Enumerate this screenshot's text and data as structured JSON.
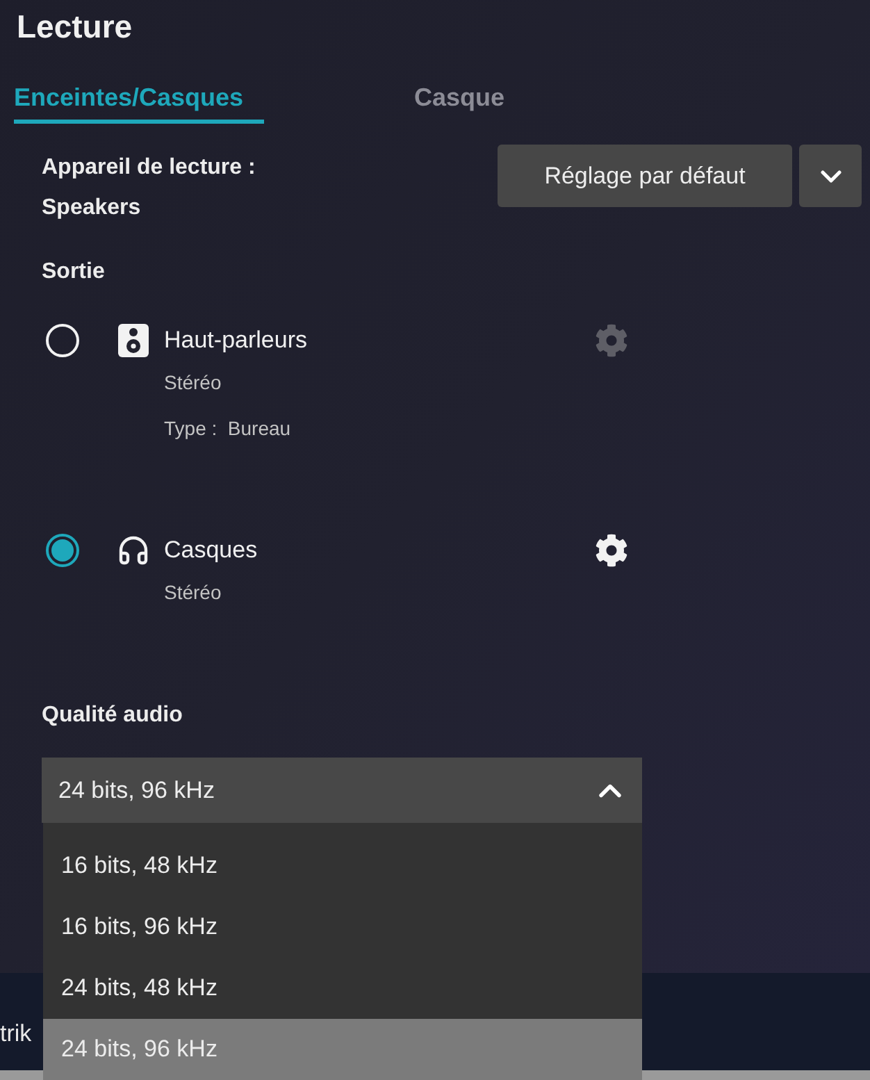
{
  "header": {
    "title": "Lecture"
  },
  "tabs": [
    {
      "label": "Enceintes/Casques",
      "selected": true
    },
    {
      "label": "Casque",
      "selected": false
    }
  ],
  "device": {
    "label": "Appareil de lecture :",
    "value": "Speakers",
    "preset": "Réglage par défaut"
  },
  "output": {
    "heading": "Sortie",
    "devices": [
      {
        "kind": "speakers",
        "name": "Haut-parleurs",
        "details": [
          "Stéréo",
          "Type :  Bureau"
        ],
        "selected": false
      },
      {
        "kind": "headphones",
        "name": "Casques",
        "details": [
          "Stéréo"
        ],
        "selected": true
      }
    ]
  },
  "audio_quality": {
    "heading": "Qualité audio",
    "value": "24 bits, 96 kHz",
    "expanded": true,
    "options": [
      {
        "label": "16 bits, 48 kHz",
        "selected": false
      },
      {
        "label": "16 bits, 96 kHz",
        "selected": false
      },
      {
        "label": "24 bits, 48 kHz",
        "selected": false
      },
      {
        "label": "24 bits, 96 kHz",
        "selected": true
      }
    ]
  },
  "background": {
    "text": "trik"
  }
}
